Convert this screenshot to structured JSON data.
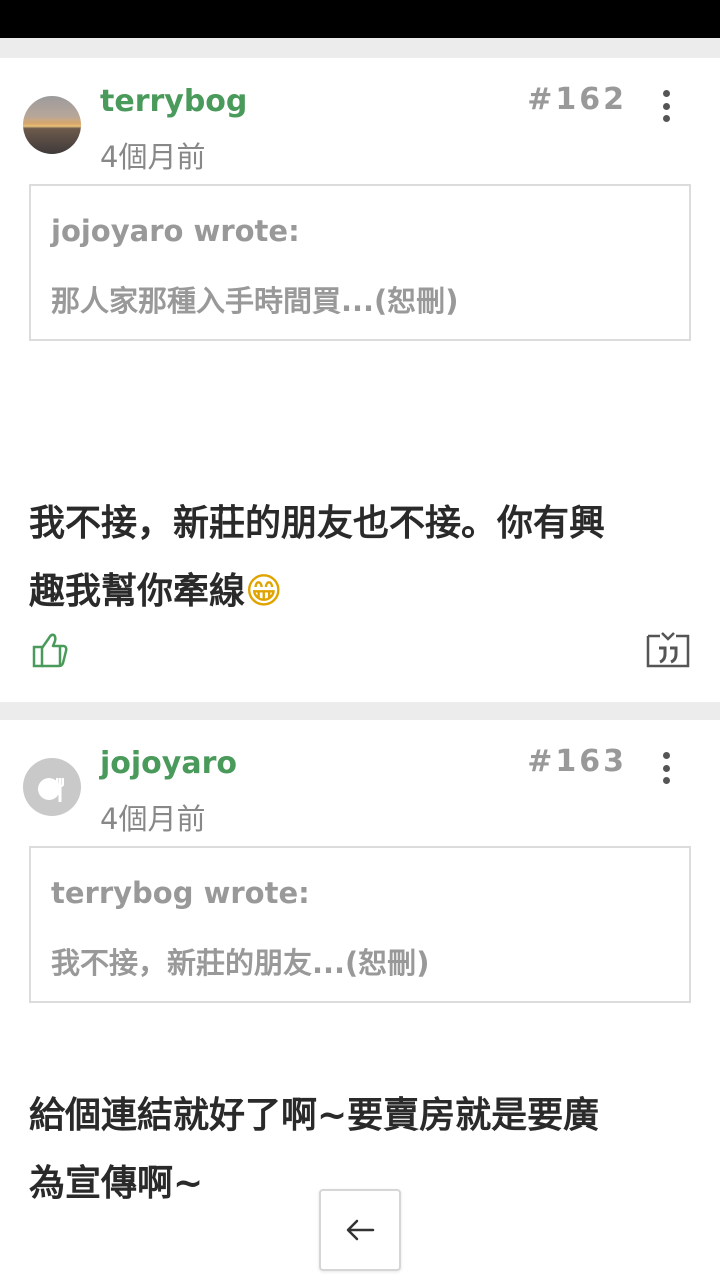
{
  "posts": [
    {
      "username": "terrybog",
      "time": "4個月前",
      "number": "#162",
      "quote": {
        "author": "jojoyaro wrote:",
        "text": "那人家那種入手時間買...(恕刪)"
      },
      "body_line1": "我不接，新莊的朋友也不接。你有興",
      "body_line2": "趣我幫你牽線",
      "emoji": "😁"
    },
    {
      "username": "jojoyaro",
      "time": "4個月前",
      "number": "#163",
      "quote": {
        "author": "terrybog wrote:",
        "text": "我不接，新莊的朋友...(恕刪)"
      },
      "body_line1": "給個連結就好了啊~要賣房就是要廣",
      "body_line2": "為宣傳啊~"
    }
  ],
  "icons": {
    "like": "thumbs-up-icon",
    "quote": "quote-reply-icon",
    "more": "more-vertical-icon",
    "back": "arrow-left-icon"
  },
  "colors": {
    "username": "#4a9a5c",
    "muted": "#999999",
    "background": "#ececec"
  }
}
